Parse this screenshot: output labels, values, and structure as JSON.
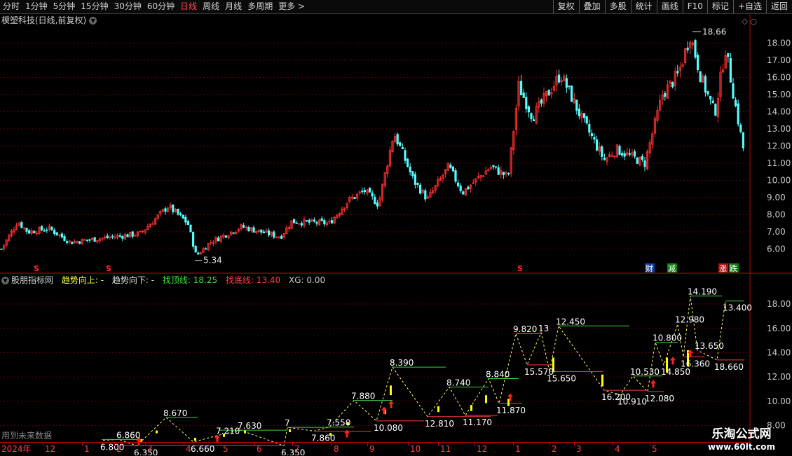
{
  "toolbar": {
    "periods": [
      "分时",
      "1分钟",
      "5分钟",
      "15分钟",
      "30分钟",
      "60分钟",
      "日线",
      "周线",
      "月线",
      "多周期",
      "更多 >"
    ],
    "active": "日线",
    "actions": [
      "复权",
      "叠加",
      "多股",
      "统计",
      "画线",
      "F10",
      "标记",
      "+自选",
      "返回"
    ]
  },
  "main_panel": {
    "title": "模塑科技(日线,前复权)",
    "high_label": "18.66",
    "low_label": "5.34",
    "y_ticks": [
      "18.00",
      "17.00",
      "16.00",
      "15.00",
      "14.00",
      "13.00",
      "12.00",
      "11.00",
      "10.00",
      "9.00",
      "8.00",
      "7.00",
      "6.00"
    ],
    "markers": {
      "s": "S",
      "cai": "财",
      "jian": "减",
      "zhang": "涨",
      "die": "跌"
    }
  },
  "indicator_panel": {
    "name": "股朋指标网",
    "up": "趋势向上: -",
    "down": "趋势向下: -",
    "top_line": "找顶线: 18.25",
    "bottom_line": "找底线: 13.40",
    "xg": "XG: 0.00",
    "y_ticks": [
      "18.00",
      "16.00",
      "14.00",
      "12.00",
      "10.00",
      "8.00"
    ],
    "labels": [
      "6.800",
      "6.860",
      "6.350",
      "8.670",
      "6.660",
      "7.210",
      "7.630",
      "6.350",
      "7",
      "7.860",
      "7.550",
      "7.880",
      "10.080",
      "8.390",
      "12.810",
      "8.740",
      "11.170",
      "8.840",
      "11.870",
      "9.820",
      "15.570",
      "13",
      "15.650",
      "12.450",
      "16.200",
      "10.910",
      "10.530",
      "12.080",
      "10.800",
      "14.850",
      "12.980",
      "16.360",
      "13.650",
      "14.190",
      "18.660",
      "13.400",
      "18.250"
    ]
  },
  "time_axis": {
    "labels": [
      "2024年",
      "12",
      "1",
      "2",
      "3",
      "4",
      "5",
      "6",
      "7",
      "8",
      "9",
      "10",
      "11",
      "12",
      "1",
      "2",
      "3",
      "4",
      "5"
    ]
  },
  "bottom_note": "用到未来数据",
  "watermark": {
    "line1": "乐淘公式网",
    "line2": "www.60lt.com"
  },
  "colors": {
    "up": "#ff3232",
    "down": "#54fcfc",
    "support": "#ff3a3a",
    "resist": "#3cd23c",
    "zigzag": "#ffff66",
    "axis": "#c00000"
  },
  "chart_data": [
    {
      "type": "line",
      "title": "模塑科技(日线,前复权)",
      "ylim": [
        5.0,
        19.0
      ],
      "x": [
        "2023-12",
        "2024-01",
        "2024-02",
        "2024-03",
        "2024-04",
        "2024-05",
        "2024-06",
        "2024-07",
        "2024-08",
        "2024-09",
        "2024-10",
        "2024-11",
        "2024-12",
        "2025-01",
        "2025-02",
        "2025-03",
        "2025-04",
        "2025-05"
      ],
      "series": [
        {
          "name": "",
          "values": [
            6.1,
            7.2,
            6.6,
            6.9,
            7.8,
            8.2,
            6.4,
            7.1,
            7.3,
            7.0,
            9.4,
            10.5,
            9.1,
            10.2,
            14.9,
            15.8,
            11.7,
            17.4,
            11.1
          ]
        }
      ],
      "annotations": [
        "18.66",
        "5.34"
      ]
    },
    {
      "type": "line",
      "title": "股朋指标网",
      "ylim": [
        7.0,
        19.5
      ],
      "series": [
        {
          "name": "找顶线",
          "values": [
            18.25
          ]
        },
        {
          "name": "找底线",
          "values": [
            13.4
          ]
        }
      ],
      "zigzag": [
        6.8,
        6.86,
        6.35,
        8.67,
        6.66,
        7.21,
        7.63,
        6.35,
        7.86,
        7.55,
        7.88,
        10.08,
        8.39,
        12.81,
        8.74,
        11.17,
        8.84,
        11.87,
        9.82,
        15.57,
        13.0,
        15.65,
        12.45,
        16.2,
        10.91,
        10.53,
        12.08,
        10.8,
        14.85,
        12.98,
        16.36,
        13.65,
        14.19,
        18.66,
        13.4,
        18.25
      ]
    }
  ]
}
